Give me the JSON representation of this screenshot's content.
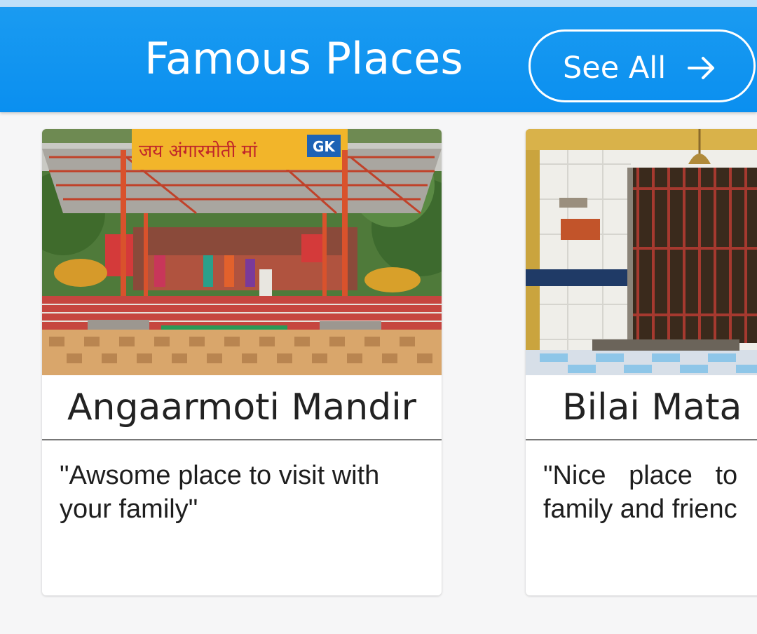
{
  "header": {
    "title": "Famous Places",
    "see_all_label": "See All",
    "see_all_icon": "arrow-right-icon"
  },
  "places": [
    {
      "name": "Angaarmoti Mandir",
      "review": "\"Awsome place to visit with your family\"",
      "sign_text": "जय अंगारमोती मां",
      "sign_logo": "GK"
    },
    {
      "name": "Bilai Mata",
      "review_line1": "\"Nice place to",
      "review_line2": "family and frienc"
    }
  ],
  "colors": {
    "header": "#1a9bf1",
    "background": "#f6f6f7",
    "card": "#ffffff"
  }
}
